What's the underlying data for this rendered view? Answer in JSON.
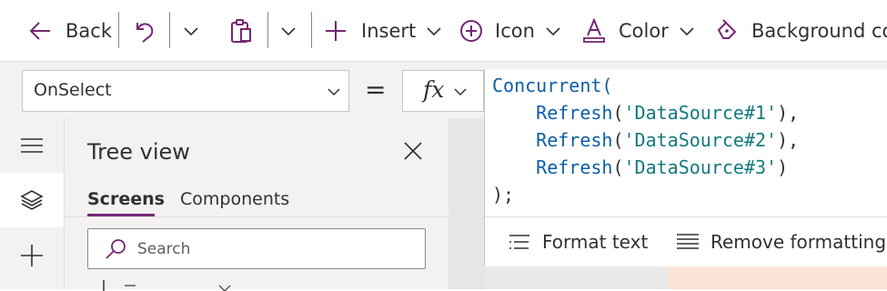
{
  "toolbar": {
    "back_label": "Back",
    "insert_label": "Insert",
    "icon_label": "Icon",
    "color_label": "Color",
    "background_color_label": "Background colo"
  },
  "formula_bar": {
    "property": "OnSelect",
    "equals": "=",
    "fx": "fx",
    "code": {
      "line1": "Concurrent(",
      "refresh_fn": "Refresh",
      "sources": [
        "'DataSource#1'",
        "'DataSource#2'",
        "'DataSource#3'"
      ],
      "close": ");"
    },
    "format_text_label": "Format text",
    "remove_formatting_label": "Remove formatting"
  },
  "tree_view": {
    "title": "Tree view",
    "tabs": [
      {
        "label": "Screens",
        "active": true
      },
      {
        "label": "Components",
        "active": false
      }
    ],
    "search_placeholder": "Search"
  },
  "colors": {
    "accent": "#742774",
    "code_function": "#0b5ea8",
    "code_string": "#137a7f",
    "canvas_screen": "#fce4d9"
  }
}
